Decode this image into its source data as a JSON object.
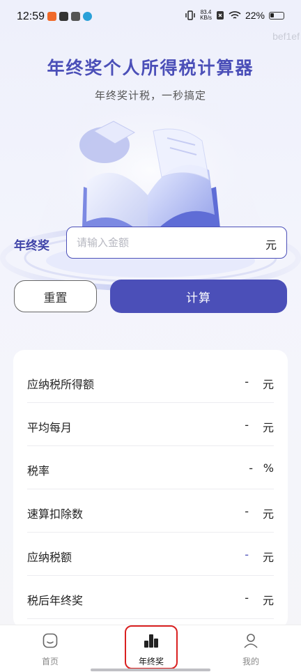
{
  "status_bar": {
    "time": "12:59",
    "net_speed_value": "83.4",
    "net_speed_unit": "KB/s",
    "battery": "22%"
  },
  "watermark": "bef1ef",
  "header": {
    "title": "年终奖个人所得税计算器",
    "subtitle": "年终奖计税，一秒搞定"
  },
  "input": {
    "label": "年终奖",
    "placeholder": "请输入金额",
    "value": "",
    "unit": "元"
  },
  "buttons": {
    "reset": "重置",
    "calculate": "计算"
  },
  "results": [
    {
      "label": "应纳税所得额",
      "value": "-",
      "unit": "元"
    },
    {
      "label": "平均每月",
      "value": "-",
      "unit": "元"
    },
    {
      "label": "税率",
      "value": "-",
      "unit": "%"
    },
    {
      "label": "速算扣除数",
      "value": "-",
      "unit": "元"
    },
    {
      "label": "应纳税额",
      "value": "-",
      "unit": "元"
    },
    {
      "label": "税后年终奖",
      "value": "-",
      "unit": "元"
    }
  ],
  "tabs": [
    {
      "label": "首页",
      "icon": "home-icon"
    },
    {
      "label": "年终奖",
      "icon": "bar-chart-icon",
      "active": true
    },
    {
      "label": "我的",
      "icon": "user-icon"
    }
  ],
  "colors": {
    "accent": "#4b4fb8",
    "highlight": "#d92020"
  }
}
